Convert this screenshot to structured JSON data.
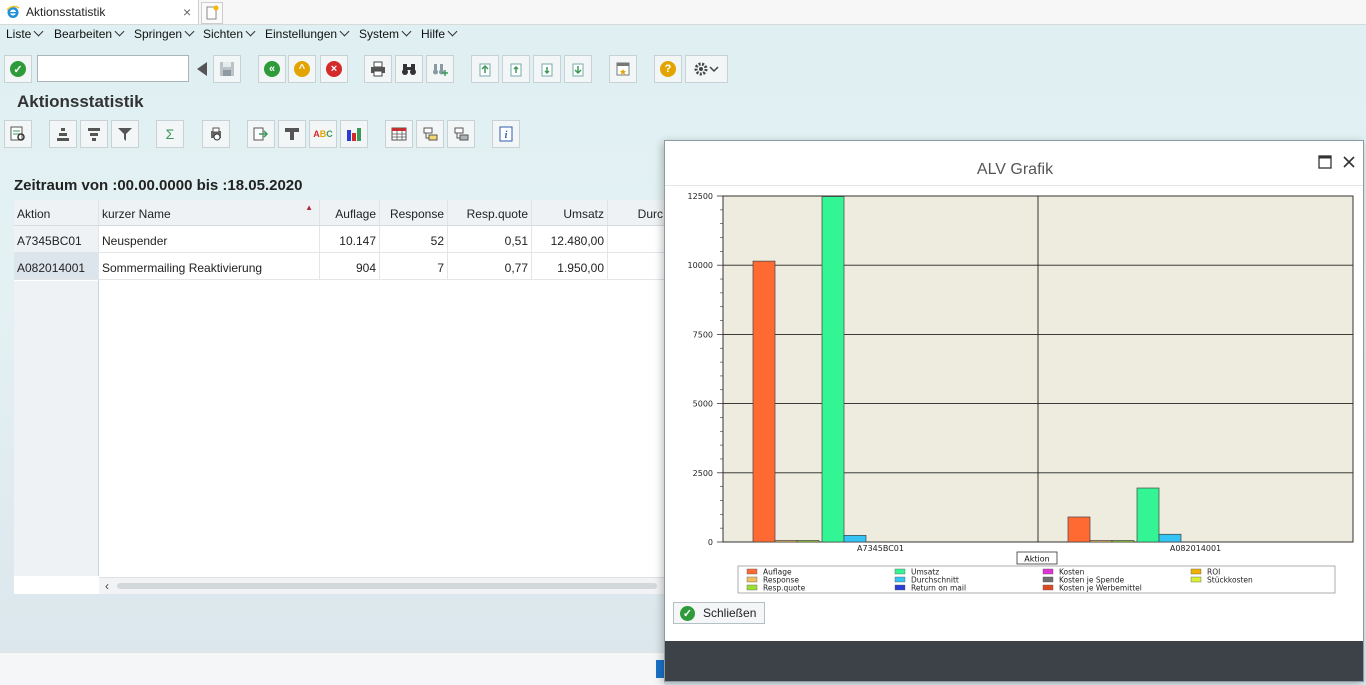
{
  "browser": {
    "tab_title": "Aktionsstatistik"
  },
  "menu": [
    "Liste",
    "Bearbeiten",
    "Springen",
    "Sichten",
    "Einstellungen",
    "System",
    "Hilfe"
  ],
  "toolbar": {
    "command_value": ""
  },
  "page": {
    "title": "Aktionsstatistik",
    "period": "Zeitraum von :00.00.0000 bis :18.05.2020"
  },
  "table": {
    "columns": [
      "Aktion",
      "kurzer Name",
      "Auflage",
      "Response",
      "Resp.quote",
      "Umsatz",
      "Durc"
    ],
    "rows": [
      [
        "A7345BC01",
        "Neuspender",
        "10.147",
        "52",
        "0,51",
        "12.480,00"
      ],
      [
        "A082014001",
        "Sommermailing Reaktivierung",
        "904",
        "7",
        "0,77",
        "1.950,00"
      ]
    ]
  },
  "dialog": {
    "title": "ALV Grafik",
    "close_label": "Schließen"
  },
  "chart_data": {
    "type": "bar",
    "xlabel": "Aktion",
    "ylim": [
      0,
      12500
    ],
    "yticks": [
      "0",
      "2500",
      "5000",
      "7500",
      "10000",
      "12500"
    ],
    "categories": [
      "A7345BC01",
      "A082014001"
    ],
    "series": [
      {
        "name": "Auflage",
        "color": "#ff6a33",
        "values": [
          10147,
          904
        ]
      },
      {
        "name": "Response",
        "color": "#f0c060",
        "values": [
          52,
          7
        ]
      },
      {
        "name": "Resp.quote",
        "color": "#99e033",
        "values": [
          0.51,
          0.77
        ]
      },
      {
        "name": "Umsatz",
        "color": "#33f594",
        "values": [
          12480,
          1950
        ]
      },
      {
        "name": "Durchschnitt",
        "color": "#33c4f5",
        "values": [
          240,
          279
        ]
      },
      {
        "name": "Return on mail",
        "color": "#2b3dd9",
        "values": [
          0,
          0
        ]
      },
      {
        "name": "Kosten",
        "color": "#e033d9",
        "values": [
          0,
          0
        ]
      },
      {
        "name": "Kosten je Spende",
        "color": "#707070",
        "values": [
          0,
          0
        ]
      },
      {
        "name": "Kosten je Werbemittel",
        "color": "#e04a1f",
        "values": [
          0,
          0
        ]
      },
      {
        "name": "ROI",
        "color": "#f0b000",
        "values": [
          0,
          0
        ]
      },
      {
        "name": "Stückkosten",
        "color": "#d9f033",
        "values": [
          0,
          0
        ]
      }
    ],
    "grid": true,
    "legend": "bottom"
  }
}
